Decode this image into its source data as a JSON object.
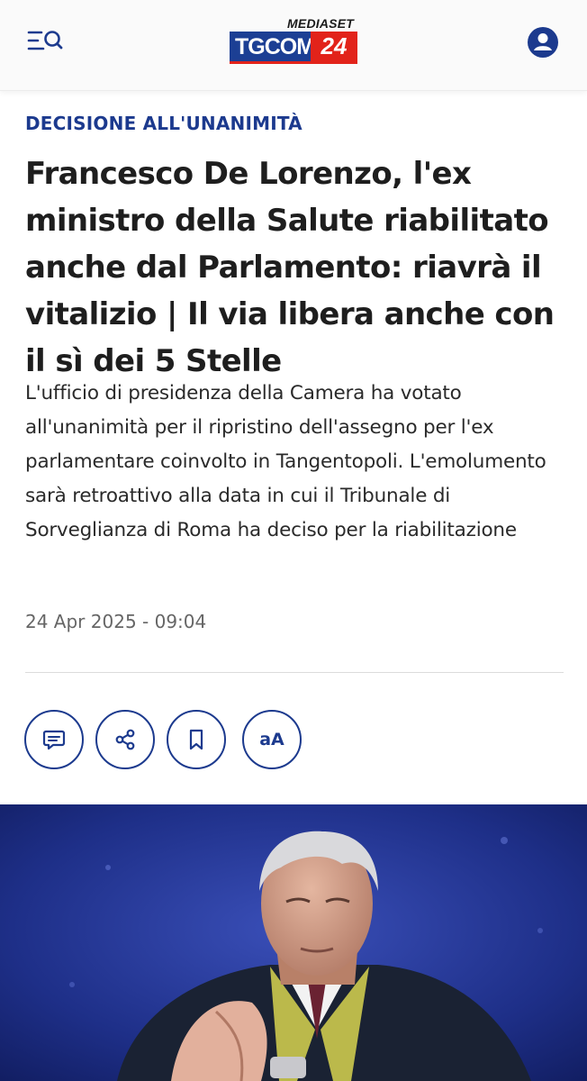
{
  "header": {
    "menu_icon": "menu-search-icon",
    "logo": {
      "top": "MEDIASET",
      "brand": "TGCOM",
      "number": "24"
    },
    "user_icon": "user-account-icon",
    "colors": {
      "brand_blue": "#1c3f94",
      "brand_red": "#e2231a"
    }
  },
  "article": {
    "kicker": "DECISIONE ALL'UNANIMITÀ",
    "title": "Francesco De Lorenzo, l'ex ministro della Salute riabilitato anche dal Parlamento: riavrà il vitalizio | Il via libera anche con il sì dei 5 Stelle",
    "summary": "L'ufficio di presidenza della Camera ha votato all'unanimità per il ripristino dell'assegno per l'ex parlamentare coinvolto in Tangentopoli. L'emolumento sarà retroattivo alla data in cui il Tribunale di Sorveglianza di Roma ha deciso per la riabilitazione",
    "date": "24 Apr 2025 - 09:04"
  },
  "actions": {
    "comment_icon": "comment-icon",
    "share_icon": "share-icon",
    "bookmark_icon": "bookmark-icon",
    "font_size_label": "aA"
  },
  "image": {
    "subject": "lead-photo"
  }
}
